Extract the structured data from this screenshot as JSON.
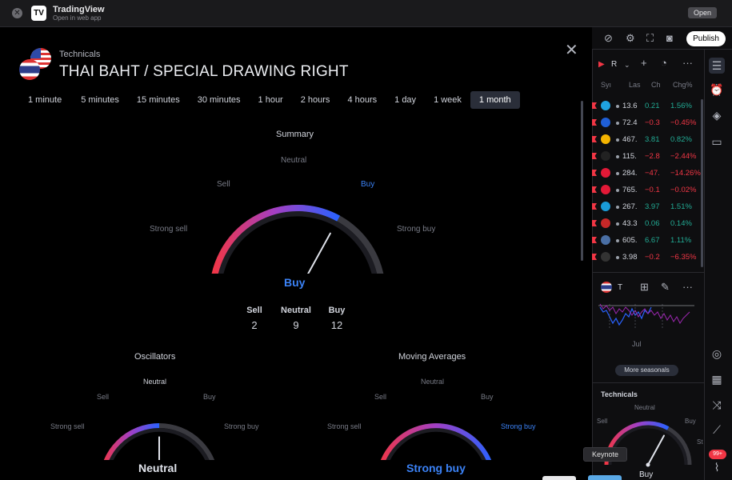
{
  "app": {
    "name": "TradingView",
    "subtitle": "Open in web app",
    "open_label": "Open"
  },
  "dialog": {
    "subtitle": "Technicals",
    "title": "THAI BAHT / SPECIAL DRAWING RIGHT",
    "tabs": [
      "1 minute",
      "5 minutes",
      "15 minutes",
      "30 minutes",
      "1 hour",
      "2 hours",
      "4 hours",
      "1 day",
      "1 week",
      "1 month"
    ],
    "active_tab": "1 month"
  },
  "summary": {
    "title": "Summary",
    "labels": {
      "strong_sell": "Strong sell",
      "sell": "Sell",
      "neutral": "Neutral",
      "buy": "Buy",
      "strong_buy": "Strong buy"
    },
    "result": "Buy",
    "needle_value": 0.32,
    "counts": [
      {
        "label": "Sell",
        "value": "2"
      },
      {
        "label": "Neutral",
        "value": "9"
      },
      {
        "label": "Buy",
        "value": "12"
      }
    ]
  },
  "oscillators": {
    "title": "Oscillators",
    "labels": {
      "strong_sell": "Strong sell",
      "sell": "Sell",
      "neutral": "Neutral",
      "buy": "Buy",
      "strong_buy": "Strong buy"
    },
    "result": "Neutral",
    "needle_value": 0.0
  },
  "moving_averages": {
    "title": "Moving Averages",
    "labels": {
      "strong_sell": "Strong sell",
      "sell": "Sell",
      "neutral": "Neutral",
      "buy": "Buy",
      "strong_buy": "Strong buy"
    },
    "result": "Strong buy",
    "needle_value": 0.88
  },
  "colors": {
    "sell": "#f23645",
    "buy": "#2962ff",
    "neutral_track": "#3a3a40",
    "muted": "#787b86",
    "result_buy": "#3b82f6",
    "result_neutral": "#e0e3eb"
  },
  "right_panel": {
    "publish_label": "Publish",
    "watchlist_name": "R",
    "columns": [
      "Syı",
      "Las",
      "Ch",
      "Chg%"
    ],
    "rows": [
      {
        "icon": "msft-icon",
        "sym_color": "#1fa3e0",
        "last": "13.6",
        "ch": "0.21",
        "chp": "1.56%",
        "dir": "up"
      },
      {
        "icon": "paypal-icon",
        "sym_color": "#1f5fd6",
        "last": "72.4",
        "ch": "−0.3",
        "chp": "−0.45%",
        "dir": "dn"
      },
      {
        "icon": "msft-icon",
        "sym_color": "#f4b400",
        "last": "467.",
        "ch": "3.81",
        "chp": "0.82%",
        "dir": "up"
      },
      {
        "icon": "arrow-icon",
        "sym_color": "#222",
        "last": "115.",
        "ch": "−2.8",
        "chp": "−2.44%",
        "dir": "dn"
      },
      {
        "icon": "tesla-icon",
        "sym_color": "#e31937",
        "last": "284.",
        "ch": "−47.",
        "chp": "−14.26%",
        "dir": "dn"
      },
      {
        "icon": "ring-icon",
        "sym_color": "#e31937",
        "last": "765.",
        "ch": "−0.1",
        "chp": "−0.02%",
        "dir": "dn"
      },
      {
        "icon": "cloud-icon",
        "sym_color": "#1a9bd7",
        "last": "267.",
        "ch": "3.97",
        "chp": "1.51%",
        "dir": "up"
      },
      {
        "icon": "check-icon",
        "sym_color": "#c62828",
        "last": "43.3",
        "ch": "0.06",
        "chp": "0.14%",
        "dir": "up"
      },
      {
        "icon": "globe-icon",
        "sym_color": "#4a6fa5",
        "last": "605.",
        "ch": "6.67",
        "chp": "1.11%",
        "dir": "up"
      },
      {
        "icon": "q-icon",
        "sym_color": "#333",
        "last": "3.98",
        "ch": "−0.2",
        "chp": "−6.35%",
        "dir": "dn"
      }
    ],
    "detail_symbol": "T",
    "chart_month": "Jul",
    "more_seasonals": "More seasonals",
    "technicals_title": "Technicals",
    "mini_gauge": {
      "sell": "Sell",
      "neutral": "Neutral",
      "buy": "Buy",
      "strong": "St",
      "result": "Buy"
    },
    "notification_count": "99+"
  },
  "tooltip": {
    "text": "Keynote"
  }
}
